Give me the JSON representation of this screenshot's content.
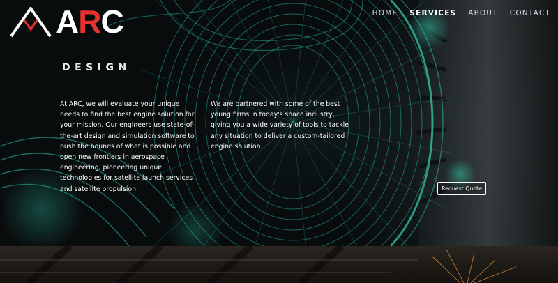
{
  "brand": {
    "name_prefix": "A",
    "name_accent": "R",
    "name_suffix": "C"
  },
  "nav": {
    "items": [
      {
        "label": "HOME",
        "active": false
      },
      {
        "label": "SERVICES",
        "active": true
      },
      {
        "label": "ABOUT",
        "active": false
      },
      {
        "label": "CONTACT",
        "active": false
      }
    ]
  },
  "hero": {
    "heading": "DESIGN",
    "col1": "At ARC, we will evaluate your unique needs to find the best engine solution for your mission. Our engineers use state-of-the-art design and simulation software to push the bounds of what is possible and open new frontiers in aerospace engineering, pioneering unique technologies for satellite launch services and satellite propulsion.",
    "col2": "We are partnered with some of the best young firms in today's space industry, giving you a wide variety of tools to tackle any situation to deliver a custom-tailored engine solution.",
    "cta_label": "Request Quote"
  },
  "colors": {
    "accent": "#e8322f",
    "wire": "#38e6c8",
    "text": "#ffffff"
  },
  "icons": {
    "background_image": "engine-wireframe-image",
    "footer_image": "metal-texture-image"
  }
}
